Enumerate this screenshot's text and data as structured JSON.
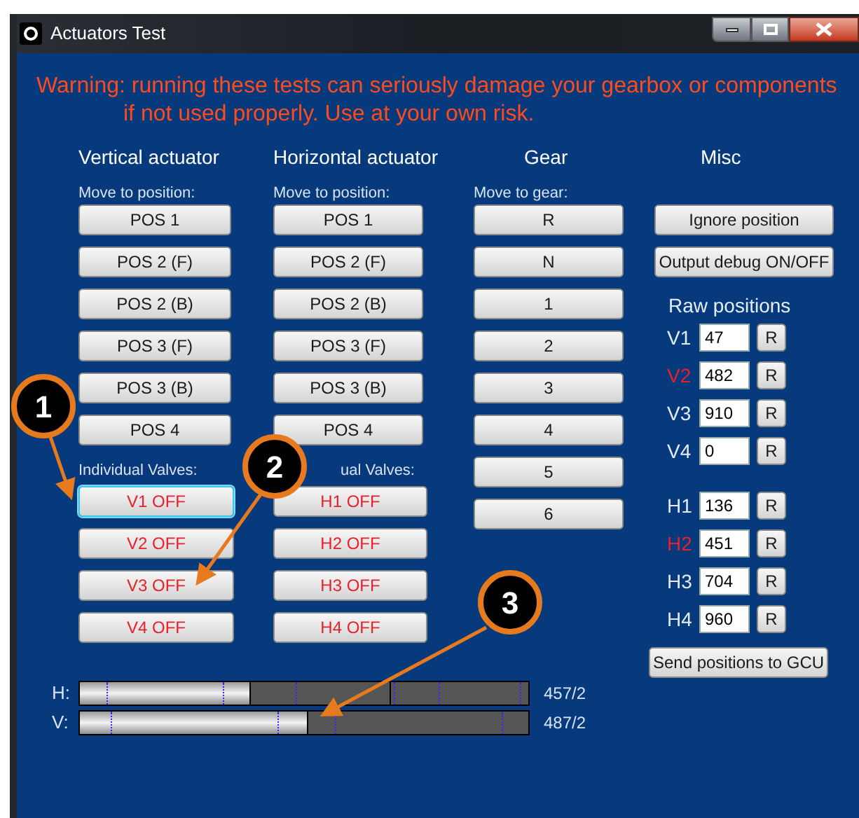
{
  "window": {
    "title": "Actuators Test"
  },
  "warning": [
    "Warning: running these tests can seriously damage your gearbox or components",
    "if not used properly. Use at your own risk."
  ],
  "vertical": {
    "heading": "Vertical actuator",
    "move_label": "Move to position:",
    "positions": [
      "POS 1",
      "POS 2 (F)",
      "POS 2 (B)",
      "POS 3 (F)",
      "POS 3 (B)",
      "POS 4"
    ],
    "valves_label": "Individual Valves:",
    "valves": [
      {
        "label": "V1 OFF",
        "focused": true
      },
      {
        "label": "V2 OFF",
        "focused": false
      },
      {
        "label": "V3 OFF",
        "focused": false
      },
      {
        "label": "V4 OFF",
        "focused": false
      }
    ]
  },
  "horizontal": {
    "heading": "Horizontal actuator",
    "move_label": "Move to position:",
    "positions": [
      "POS 1",
      "POS 2 (F)",
      "POS 2 (B)",
      "POS 3 (F)",
      "POS 3 (B)",
      "POS 4"
    ],
    "valves_label": "ual Valves:",
    "valves": [
      {
        "label": "H1 OFF",
        "focused": false
      },
      {
        "label": "H2 OFF",
        "focused": false
      },
      {
        "label": "H3 OFF",
        "focused": false
      },
      {
        "label": "H4 OFF",
        "focused": false
      }
    ]
  },
  "gear": {
    "heading": "Gear",
    "move_label": "Move to gear:",
    "gears": [
      "R",
      "N",
      "1",
      "2",
      "3",
      "4",
      "5",
      "6"
    ]
  },
  "misc": {
    "heading": "Misc",
    "buttons": [
      "Ignore position",
      "Output debug ON/OFF"
    ],
    "raw_heading": "Raw positions",
    "raw": [
      {
        "name": "V1",
        "value": "47",
        "alert": false,
        "reset": "R"
      },
      {
        "name": "V2",
        "value": "482",
        "alert": true,
        "reset": "R"
      },
      {
        "name": "V3",
        "value": "910",
        "alert": false,
        "reset": "R"
      },
      {
        "name": "V4",
        "value": "0",
        "alert": false,
        "reset": "R"
      },
      {
        "name": "H1",
        "value": "136",
        "alert": false,
        "reset": "R"
      },
      {
        "name": "H2",
        "value": "451",
        "alert": true,
        "reset": "R"
      },
      {
        "name": "H3",
        "value": "704",
        "alert": false,
        "reset": "R"
      },
      {
        "name": "H4",
        "value": "960",
        "alert": false,
        "reset": "R"
      }
    ],
    "send": "Send positions to GCU"
  },
  "bars": [
    {
      "label": "H:",
      "level": 0.38,
      "reading": "457/2"
    },
    {
      "label": "V:",
      "level": 0.51,
      "reading": "487/2"
    }
  ],
  "callouts": [
    {
      "label": "1"
    },
    {
      "label": "2"
    },
    {
      "label": "3"
    }
  ]
}
